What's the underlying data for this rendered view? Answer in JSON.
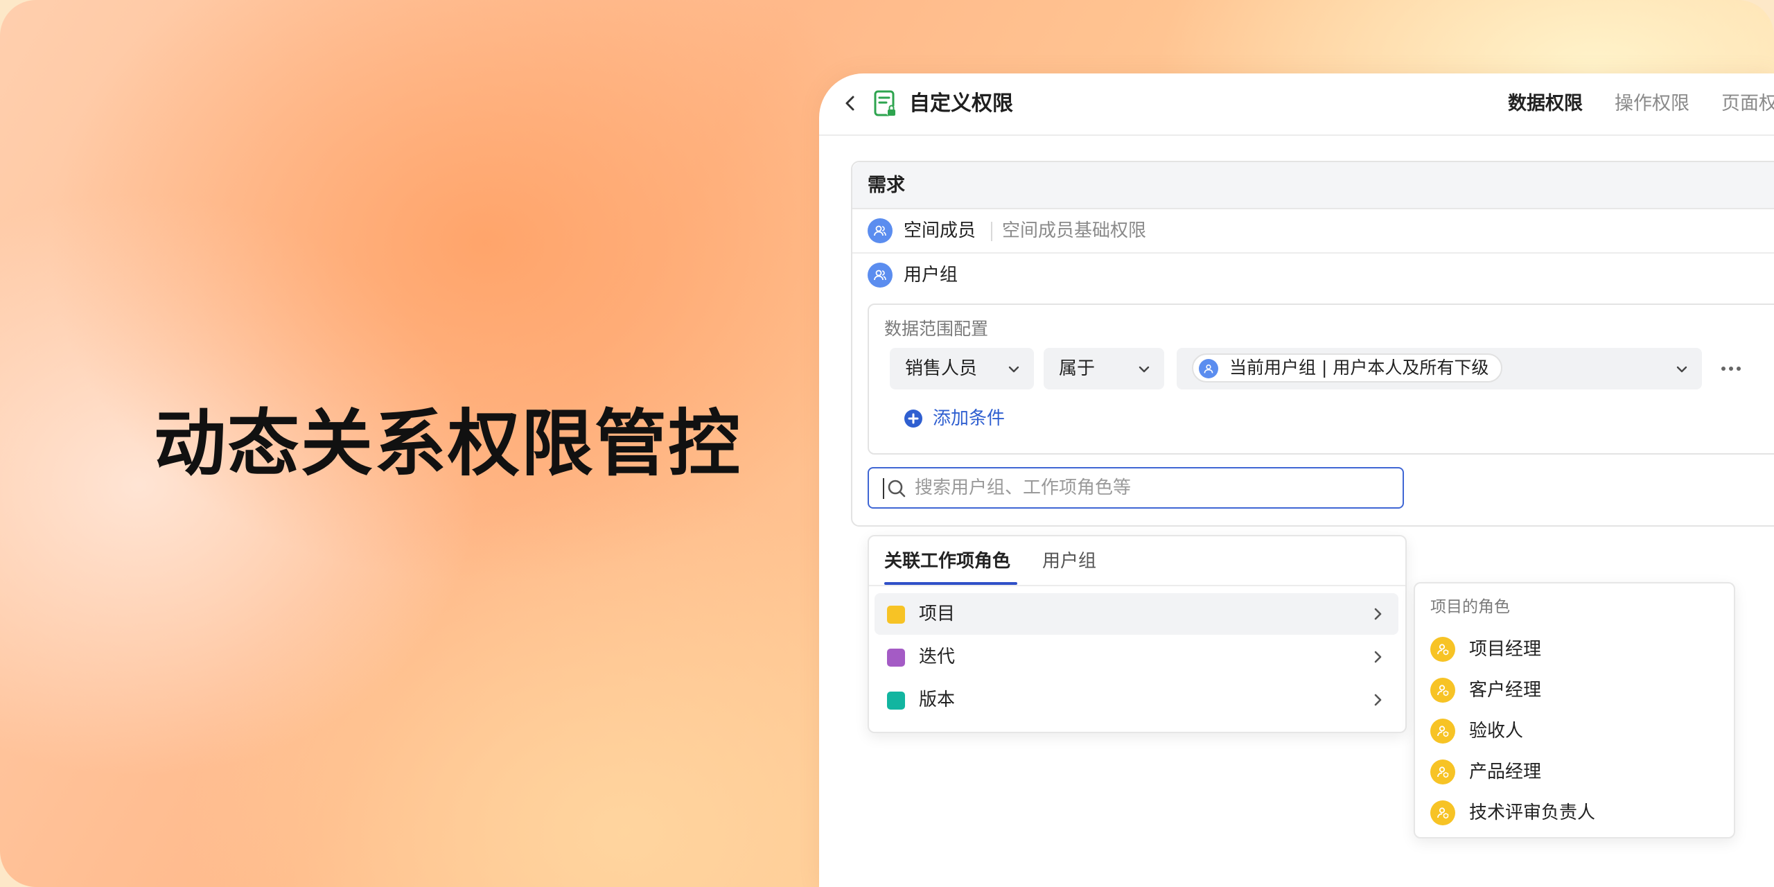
{
  "hero": {
    "title": "动态关系权限管控"
  },
  "header": {
    "title": "自定义权限",
    "tabs": [
      {
        "label": "数据权限",
        "active": true
      },
      {
        "label": "操作权限",
        "active": false
      },
      {
        "label": "页面权"
      }
    ]
  },
  "card": {
    "title": "需求",
    "rows": [
      {
        "label": "空间成员",
        "desc": "空间成员基础权限"
      },
      {
        "label": "用户组"
      }
    ]
  },
  "scope": {
    "title": "数据范围配置",
    "field_select": "销售人员",
    "operator_select": "属于",
    "value_chip": "当前用户组 | 用户本人及所有下级",
    "add_condition": "添加条件"
  },
  "search": {
    "placeholder": "搜索用户组、工作项角色等",
    "value": ""
  },
  "dropdown": {
    "tabs": [
      "关联工作项角色",
      "用户组"
    ],
    "items": [
      {
        "label": "项目",
        "color": "#f7c325"
      },
      {
        "label": "迭代",
        "color": "#a45bc5"
      },
      {
        "label": "版本",
        "color": "#12b5a0"
      }
    ]
  },
  "submenu": {
    "title": "项目的角色",
    "roles": [
      "项目经理",
      "客户经理",
      "验收人",
      "产品经理",
      "技术评审负责人"
    ]
  },
  "colors": {
    "accent": "#3050c8",
    "avatar_blue": "#5b8def",
    "role_yellow": "#f7c325",
    "doc_green": "#2ea44f"
  }
}
